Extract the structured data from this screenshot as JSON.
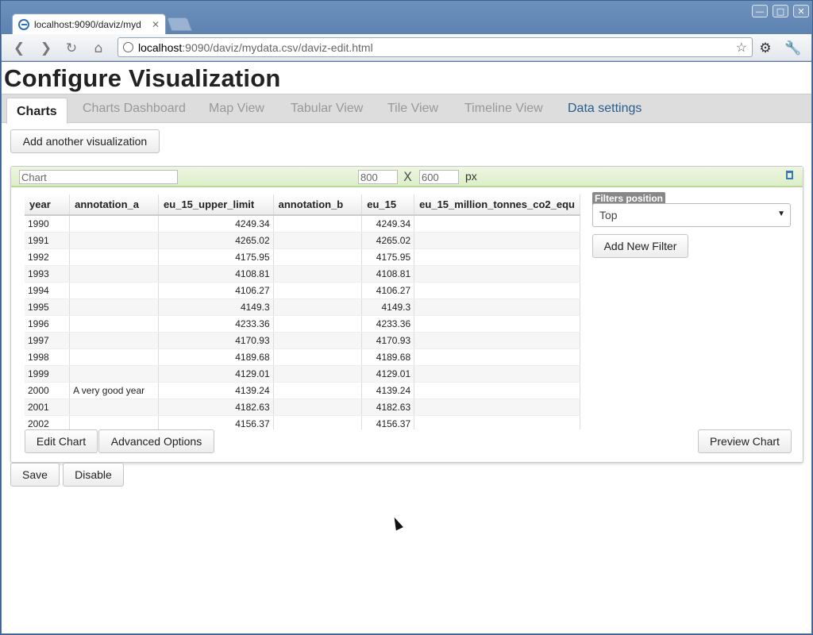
{
  "browser": {
    "tab_title": "localhost:9090/daviz/myd",
    "url_host": "localhost",
    "url_rest": ":9090/daviz/mydata.csv/daviz-edit.html"
  },
  "page": {
    "title": "Configure Visualization",
    "tabs": [
      {
        "label": "Charts",
        "state": "active"
      },
      {
        "label": "Charts Dashboard",
        "state": "disabled"
      },
      {
        "label": "Map View",
        "state": "disabled"
      },
      {
        "label": "Tabular View",
        "state": "disabled"
      },
      {
        "label": "Tile View",
        "state": "disabled"
      },
      {
        "label": "Timeline View",
        "state": "disabled"
      },
      {
        "label": "Data settings",
        "state": "link"
      }
    ],
    "add_visualization_label": "Add another visualization"
  },
  "chart_panel": {
    "name_value": "Chart",
    "width_value": "800",
    "x_label": "X",
    "height_value": "600",
    "unit_label": "px",
    "columns": [
      "year",
      "annotation_a",
      "eu_15_upper_limit",
      "annotation_b",
      "eu_15",
      "eu_15_million_tonnes_co2_equ"
    ],
    "rows": [
      [
        "1990",
        "",
        "4249.34",
        "",
        "4249.34",
        ""
      ],
      [
        "1991",
        "",
        "4265.02",
        "",
        "4265.02",
        ""
      ],
      [
        "1992",
        "",
        "4175.95",
        "",
        "4175.95",
        ""
      ],
      [
        "1993",
        "",
        "4108.81",
        "",
        "4108.81",
        ""
      ],
      [
        "1994",
        "",
        "4106.27",
        "",
        "4106.27",
        ""
      ],
      [
        "1995",
        "",
        "4149.3",
        "",
        "4149.3",
        ""
      ],
      [
        "1996",
        "",
        "4233.36",
        "",
        "4233.36",
        ""
      ],
      [
        "1997",
        "",
        "4170.93",
        "",
        "4170.93",
        ""
      ],
      [
        "1998",
        "",
        "4189.68",
        "",
        "4189.68",
        ""
      ],
      [
        "1999",
        "",
        "4129.01",
        "",
        "4129.01",
        ""
      ],
      [
        "2000",
        "A very good year",
        "4139.24",
        "",
        "4139.24",
        ""
      ],
      [
        "2001",
        "",
        "4182.63",
        "",
        "4182.63",
        ""
      ],
      [
        "2002",
        "",
        "4156.37",
        "",
        "4156.37",
        ""
      ]
    ],
    "filters_position_label": "Filters position",
    "filters_position_value": "Top",
    "add_filter_label": "Add New Filter",
    "edit_chart_label": "Edit Chart",
    "advanced_options_label": "Advanced Options",
    "preview_chart_label": "Preview Chart"
  },
  "footer": {
    "save_label": "Save",
    "disable_label": "Disable"
  }
}
